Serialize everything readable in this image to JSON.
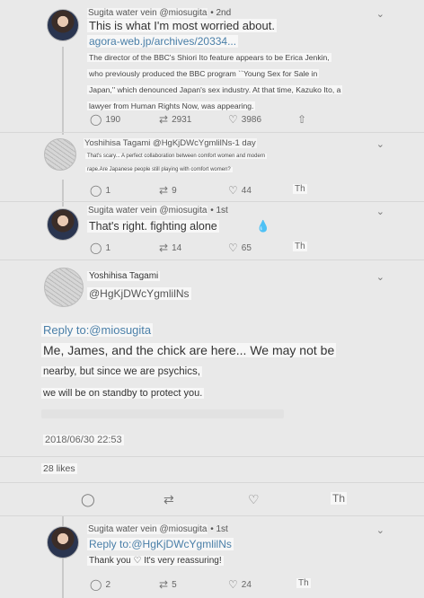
{
  "tweets": [
    {
      "author": "Sugita water vein @miosugita",
      "time": "2nd",
      "text": "This is what I'm most worried about.",
      "link": "agora-web.jp/archives/20334...",
      "card_lines": [
        "The director of the BBC's Shiori Ito feature appears to be Erica Jenkin,",
        "who previously produced the BBC program ``Young Sex for Sale in",
        "Japan,'' which denounced Japan's sex industry. At that time, Kazuko Ito, a",
        "lawyer from Human Rights Now, was appearing."
      ],
      "replies": "190",
      "retweets": "2931",
      "likes": "3986"
    },
    {
      "author": "Yoshihisa Tagami @HgKjDWcYgmlilNs-1 day",
      "text_lines": [
        "That's scary... A perfect collaboration between comfort women and modern",
        "rape.Are Japanese people still playing with comfort women?"
      ],
      "replies": "1",
      "retweets": "9",
      "likes": "44",
      "extra": "Th"
    },
    {
      "author": "Sugita water vein @miosugita",
      "time": "1st",
      "text": "That's right. fighting alone",
      "emoji": "💧",
      "replies": "1",
      "retweets": "14",
      "likes": "65",
      "extra": "Th"
    }
  ],
  "focus": {
    "name": "Yoshihisa Tagami",
    "handle": "@HgKjDWcYgmlilNs",
    "reply_to": "Reply to:@miosugita",
    "lines": [
      "Me, James, and the chick are here... We may not be",
      "nearby, but since we are psychics,",
      "we will be on standby to protect you."
    ],
    "timestamp": "2018/06/30 22:53",
    "likes_count": "28 likes",
    "extra": "Th"
  },
  "last": {
    "author": "Sugita water vein @miosugita",
    "time": "1st",
    "reply_to": "Reply to:@HgKjDWcYgmlilNs",
    "text": "Thank you ♡ It's very reassuring!",
    "replies": "2",
    "retweets": "5",
    "likes": "24",
    "extra": "Th"
  },
  "colors": {
    "link": "#4a7fa8",
    "background": "#e9e9e9"
  },
  "icons": [
    "chevron-down-icon",
    "reply-icon",
    "retweet-icon",
    "like-icon",
    "share-icon",
    "droplet-icon"
  ]
}
